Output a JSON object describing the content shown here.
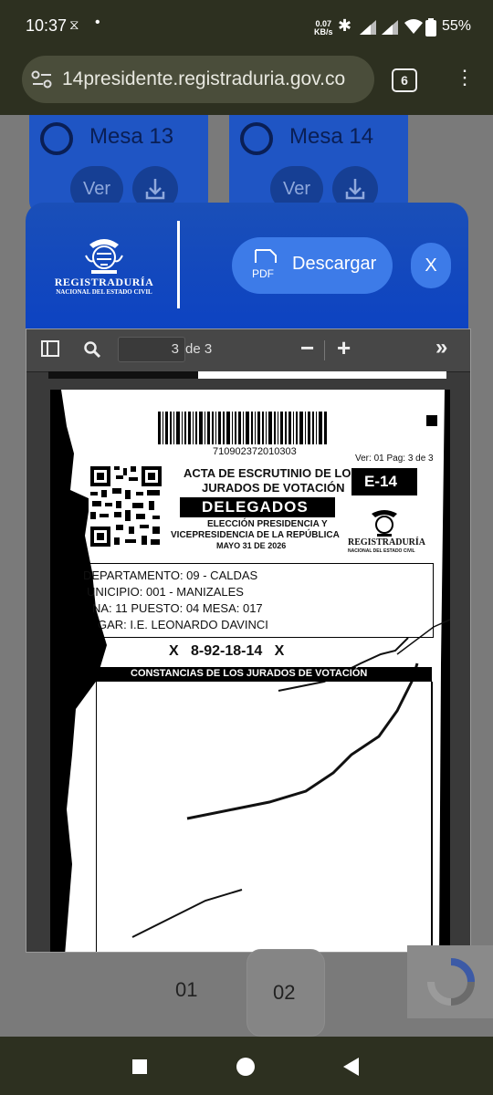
{
  "status_bar": {
    "time": "10:37",
    "net_speed_value": "0.07",
    "net_speed_unit": "KB/s",
    "battery": "55%"
  },
  "browser": {
    "url": "14presidente.registraduria.gov.co",
    "tab_count": "6"
  },
  "background_cards": [
    {
      "title": "Mesa 13",
      "view_label": "Ver"
    },
    {
      "title": "Mesa 14",
      "view_label": "Ver"
    }
  ],
  "modal": {
    "logo_name": "REGISTRADURÍA",
    "logo_sub": "NACIONAL DEL ESTADO CIVIL",
    "download_icon_text": "PDF",
    "download_label": "Descargar",
    "close_label": "X"
  },
  "viewer": {
    "page_current": "3",
    "page_of": "de 3"
  },
  "document": {
    "barcode_number": "710902372010303",
    "version": "Ver: 01 Pag: 3 de 3",
    "title_line1": "ACTA DE ESCRUTINIO DE LOS",
    "title_line2": "JURADOS DE VOTACIÓN",
    "form_code": "E-14",
    "subtitle": "DELEGADOS",
    "election_line1": "ELECCIÓN PRESIDENCIA Y",
    "election_line2": "VICEPRESIDENCIA DE LA REPÚBLICA",
    "election_date": "MAYO 31 DE 2026",
    "doc_logo_name": "REGISTRADURÍA",
    "doc_logo_sub": "NACIONAL DEL ESTADO CIVIL",
    "departamento": "DEPARTAMENTO: 09 - CALDAS",
    "municipio": "UNICIPIO: 001 - MANIZALES",
    "zona": "NA: 11  PUESTO: 04  MESA: 017",
    "lugar": "GAR: I.E. LEONARDO DAVINCI",
    "serial": "X   8-92-18-14   X",
    "section_header": "CONSTANCIAS DE LOS JURADOS DE VOTACIÓN"
  },
  "pagination": [
    "01",
    "02"
  ]
}
